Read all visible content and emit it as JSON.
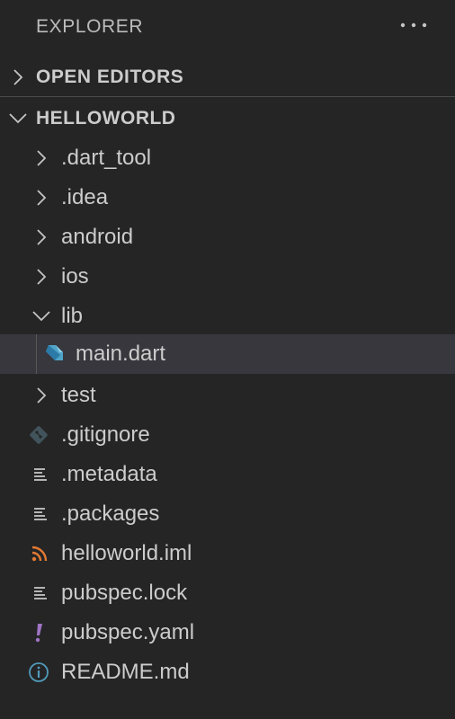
{
  "header": {
    "title": "EXPLORER",
    "more_icon": "ellipsis-icon"
  },
  "sections": {
    "open_editors": {
      "label": "OPEN EDITORS",
      "expanded": false
    },
    "project": {
      "label": "HELLOWORLD",
      "expanded": true
    }
  },
  "tree": [
    {
      "label": ".dart_tool",
      "kind": "folder",
      "expanded": false,
      "icon": "chevron-right-icon"
    },
    {
      "label": ".idea",
      "kind": "folder",
      "expanded": false,
      "icon": "chevron-right-icon"
    },
    {
      "label": "android",
      "kind": "folder",
      "expanded": false,
      "icon": "chevron-right-icon"
    },
    {
      "label": "ios",
      "kind": "folder",
      "expanded": false,
      "icon": "chevron-right-icon"
    },
    {
      "label": "lib",
      "kind": "folder",
      "expanded": true,
      "icon": "chevron-down-icon"
    },
    {
      "label": "main.dart",
      "kind": "file",
      "selected": true,
      "icon": "dart-icon"
    },
    {
      "label": "test",
      "kind": "folder",
      "expanded": false,
      "icon": "chevron-right-icon"
    },
    {
      "label": ".gitignore",
      "kind": "file",
      "icon": "git-icon"
    },
    {
      "label": ".metadata",
      "kind": "file",
      "icon": "lines-icon"
    },
    {
      "label": ".packages",
      "kind": "file",
      "icon": "lines-icon"
    },
    {
      "label": "helloworld.iml",
      "kind": "file",
      "icon": "rss-icon"
    },
    {
      "label": "pubspec.lock",
      "kind": "file",
      "icon": "lines-icon"
    },
    {
      "label": "pubspec.yaml",
      "kind": "file",
      "icon": "exclamation-icon"
    },
    {
      "label": "README.md",
      "kind": "file",
      "icon": "info-icon"
    }
  ],
  "colors": {
    "background": "#252526",
    "selected_row": "#37373d",
    "text": "#cccccc",
    "dart": "#4fa3c7",
    "git": "#41535b",
    "rss": "#e37933",
    "yaml": "#a074c4",
    "info": "#519aba"
  }
}
